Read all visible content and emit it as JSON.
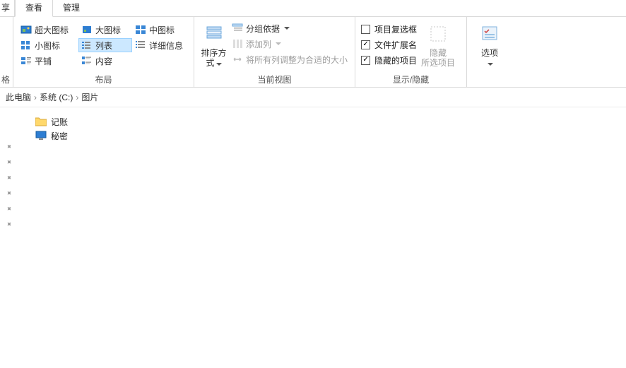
{
  "tabs": {
    "first_frag": "享",
    "view": "查看",
    "manage": "管理"
  },
  "ribbon": {
    "panes_label": "格",
    "layout": {
      "extra_large": "超大图标",
      "large": "大图标",
      "medium": "中图标",
      "small": "小图标",
      "list": "列表",
      "details": "详细信息",
      "tiles": "平铺",
      "content": "内容",
      "group_label": "布局"
    },
    "current_view": {
      "sort": "排序方式",
      "group_by": "分组依据",
      "add_columns": "添加列",
      "fit_columns": "将所有列调整为合适的大小",
      "group_label": "当前视图"
    },
    "show_hide": {
      "item_checkboxes": "项目复选框",
      "file_ext": "文件扩展名",
      "hidden_items": "隐藏的项目",
      "hide": "隐藏",
      "selected_items": "所选项目",
      "group_label": "显示/隐藏"
    },
    "options": "选项"
  },
  "breadcrumb": {
    "root": "此电脑",
    "drive": "系统 (C:)",
    "folder": "图片"
  },
  "files": {
    "item1": "记账",
    "item2": "秘密"
  }
}
